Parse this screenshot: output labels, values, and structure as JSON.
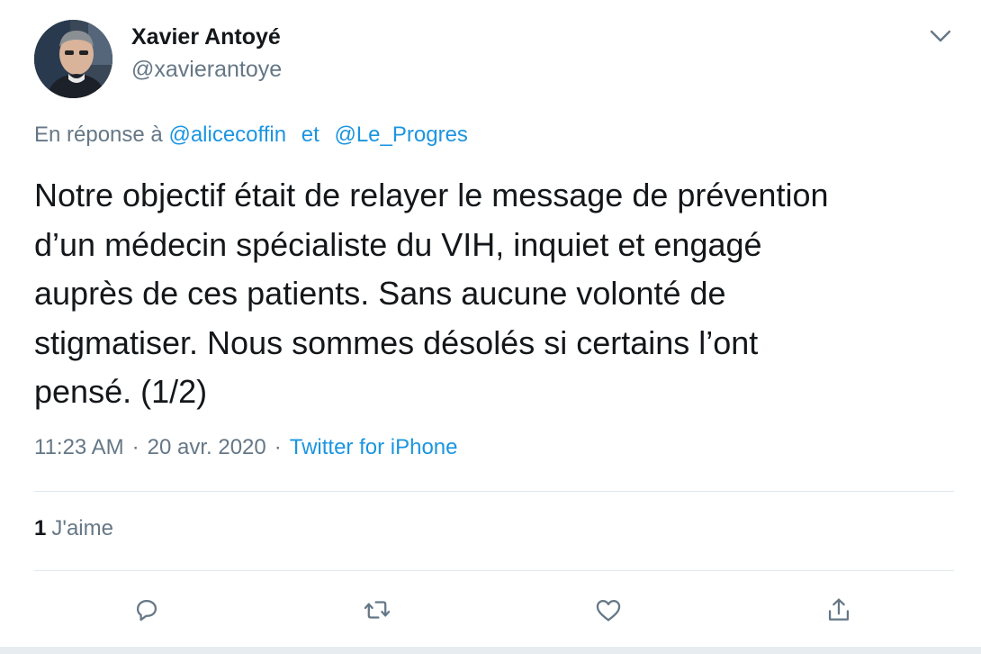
{
  "author": {
    "display_name": "Xavier Antoyé",
    "handle": "@xavierantoye",
    "avatar_icon": "profile-photo"
  },
  "reply": {
    "prefix": "En réponse à",
    "mentions": [
      "@alicecoffin",
      "@Le_Progres"
    ],
    "conjunction": "et"
  },
  "tweet": {
    "lines": [
      "Notre objectif était de relayer le message de prévention",
      "d’un médecin spécialiste du VIH, inquiet et engagé",
      "auprès de ces patients. Sans aucune volonté de",
      "stigmatiser. Nous sommes désolés si certains l’ont",
      "pensé. (1/2)"
    ]
  },
  "meta": {
    "time": "11:23 AM",
    "separator": "·",
    "date": "20 avr. 2020",
    "source": "Twitter for iPhone"
  },
  "stats": {
    "likes_count": "1",
    "likes_label": "J'aime"
  },
  "actions": {
    "icons": [
      "reply-icon",
      "retweet-icon",
      "like-icon",
      "share-icon"
    ]
  },
  "colors": {
    "text": "#14171a",
    "secondary": "#657786",
    "link": "#1b95e0",
    "divider": "#e1e8ed"
  }
}
